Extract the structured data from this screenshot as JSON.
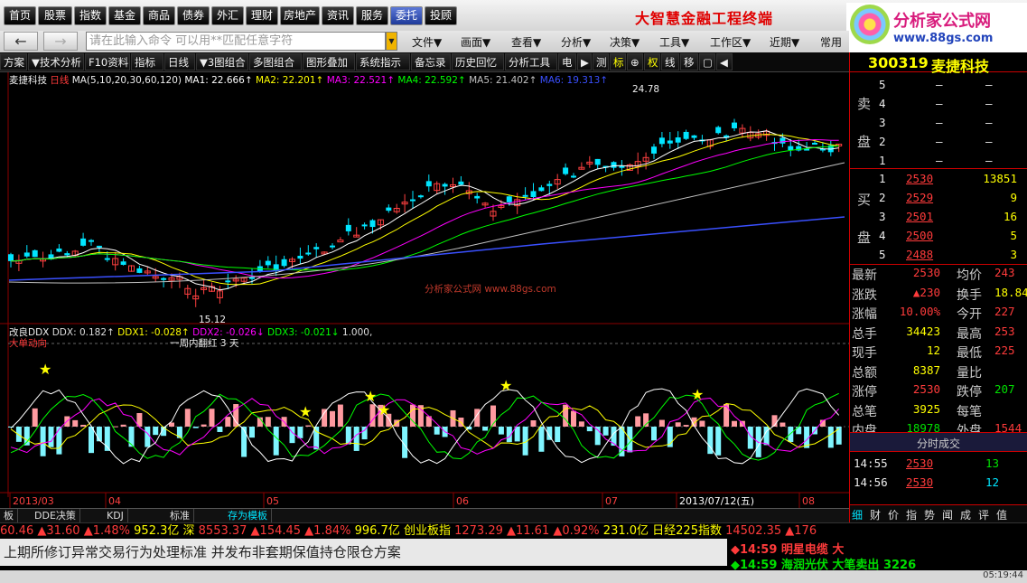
{
  "top_menu": {
    "buttons": [
      "首页",
      "股票",
      "指数",
      "基金",
      "商品",
      "债券",
      "外汇",
      "理财",
      "房地产",
      "资讯",
      "服务",
      "委托",
      "投顾"
    ],
    "active": "委托",
    "app_title": "大智慧金融工程终端"
  },
  "logo": {
    "name": "分析家公式网",
    "url": "www.88gs.com"
  },
  "nav": {
    "back": "←",
    "forward": "→",
    "command_placeholder": "请在此输入命令  可以用**匹配任意字符",
    "menus": [
      "文件▼",
      "画面▼",
      "查看▼",
      "分析▼",
      "决策▼",
      "工具▼",
      "工作区▼",
      "近期▼",
      "常用"
    ]
  },
  "toolbar": {
    "items": [
      "方案",
      "▼技术分析",
      "F10资料",
      "指标",
      "日线",
      "▼3图组合",
      "多图组合",
      "图形叠加",
      "系统指示",
      "备忘录",
      "历史回忆",
      "分析工具",
      "电",
      "▶",
      "测",
      "标",
      "⊕",
      "权",
      "线",
      "移",
      "▢",
      "◀"
    ]
  },
  "chart": {
    "stock_title": "麦捷科技",
    "period": "日线",
    "ma_param": "MA(5,10,20,30,60,120)",
    "ma_values": [
      {
        "label": "MA1: 22.666↑",
        "color": "#ffffff"
      },
      {
        "label": "MA2: 22.201↑",
        "color": "#ffff00"
      },
      {
        "label": "MA3: 22.521↑",
        "color": "#ff00ff"
      },
      {
        "label": "MA4: 22.592↑",
        "color": "#00ff00"
      },
      {
        "label": "MA5: 21.402↑",
        "color": "#c0c0c0"
      },
      {
        "label": "MA6: 19.313↑",
        "color": "#3a50ff"
      }
    ],
    "high_label": "24.78",
    "low_label": "15.12",
    "watermark": "分析家公式网 www.88gs.com",
    "ddx_title": "改良DDX",
    "ddx_values": [
      {
        "label": "DDX: 0.182↑",
        "color": "#dddddd"
      },
      {
        "label": "DDX1: -0.028↑",
        "color": "#ffff00"
      },
      {
        "label": "DDX2: -0.026↓",
        "color": "#ff00ff"
      },
      {
        "label": "DDX3: -0.021↓",
        "color": "#00ff00"
      },
      {
        "label": "1.000,",
        "color": "#dddddd"
      }
    ],
    "sub_label": "大单动向",
    "note": "一周内翻红 3 天",
    "x_labels": [
      "2013/03",
      "04",
      "05",
      "06",
      "07",
      "2013/07/12(五)",
      "08"
    ]
  },
  "bottom_tabs": [
    "板",
    "DDE决策",
    "KDJ",
    "标准",
    "存为模板"
  ],
  "ticker": [
    {
      "t": "60.46",
      "c": "#ff3b3b"
    },
    {
      "t": "▲31.60",
      "c": "#ff3b3b"
    },
    {
      "t": "▲1.48%",
      "c": "#ff3b3b"
    },
    {
      "t": "952.3亿",
      "c": "#ffff00"
    },
    {
      "t": "深",
      "c": "#ffff00"
    },
    {
      "t": "8553.37",
      "c": "#ff3b3b"
    },
    {
      "t": "▲154.45",
      "c": "#ff3b3b"
    },
    {
      "t": "▲1.84%",
      "c": "#ff3b3b"
    },
    {
      "t": "996.7亿",
      "c": "#ffff00"
    },
    {
      "t": "创业板指",
      "c": "#ffff00"
    },
    {
      "t": "1273.29",
      "c": "#ff3b3b"
    },
    {
      "t": "▲11.61",
      "c": "#ff3b3b"
    },
    {
      "t": "▲0.92%",
      "c": "#ff3b3b"
    },
    {
      "t": "231.0亿",
      "c": "#ffff00"
    },
    {
      "t": "日经225指数",
      "c": "#ffff00"
    },
    {
      "t": "14502.35",
      "c": "#ff3b3b"
    },
    {
      "t": "▲176",
      "c": "#ff3b3b"
    }
  ],
  "news": "上期所修订异常交易行为处理标准 并发布非套期保值持仓限仓方案",
  "alerts": [
    {
      "time": "14:59",
      "name": "明星电缆",
      "action": "大",
      "color": "#ff3b3b"
    },
    {
      "time": "14:59",
      "name": "海润光伏",
      "action": "大笔卖出 3226",
      "color": "#00e000"
    }
  ],
  "clock": "05:19:44",
  "side": {
    "code": "300319",
    "name": "麦捷科技",
    "sell_label": "卖 盘",
    "buy_label": "买 盘",
    "sells": [
      {
        "lv": "5",
        "p": "—",
        "v": "—"
      },
      {
        "lv": "4",
        "p": "—",
        "v": "—"
      },
      {
        "lv": "3",
        "p": "—",
        "v": "—"
      },
      {
        "lv": "2",
        "p": "—",
        "v": "—"
      },
      {
        "lv": "1",
        "p": "—",
        "v": "—"
      }
    ],
    "buys": [
      {
        "lv": "1",
        "p": "2530",
        "v": "13851"
      },
      {
        "lv": "2",
        "p": "2529",
        "v": "9"
      },
      {
        "lv": "3",
        "p": "2501",
        "v": "16"
      },
      {
        "lv": "4",
        "p": "2500",
        "v": "5"
      },
      {
        "lv": "5",
        "p": "2488",
        "v": "3"
      }
    ],
    "stats": [
      {
        "l": "最新",
        "v": "2530",
        "vc": "#ff3b3b",
        "l2": "均价",
        "v2": "243",
        "v2c": "#ff3b3b"
      },
      {
        "l": "涨跌",
        "v": "▲230",
        "vc": "#ff3b3b",
        "l2": "换手",
        "v2": "18.84",
        "v2c": "#ffff00"
      },
      {
        "l": "涨幅",
        "v": "10.00%",
        "vc": "#ff3b3b",
        "l2": "今开",
        "v2": "227",
        "v2c": "#ff3b3b"
      },
      {
        "l": "总手",
        "v": "34423",
        "vc": "#ffff00",
        "l2": "最高",
        "v2": "253",
        "v2c": "#ff3b3b"
      },
      {
        "l": "现手",
        "v": "12",
        "vc": "#ffff00",
        "l2": "最低",
        "v2": "225",
        "v2c": "#ff3b3b"
      },
      {
        "l": "总额",
        "v": "8387",
        "vc": "#ffff00",
        "l2": "量比",
        "v2": "",
        "v2c": "#ffff00"
      },
      {
        "l": "涨停",
        "v": "2530",
        "vc": "#ff3b3b",
        "l2": "跌停",
        "v2": "207",
        "v2c": "#00e000"
      },
      {
        "l": "总笔",
        "v": "3925",
        "vc": "#ffff00",
        "l2": "每笔",
        "v2": "",
        "v2c": "#ffff00"
      },
      {
        "l": "内盘",
        "v": "18978",
        "vc": "#00e000",
        "l2": "外盘",
        "v2": "1544",
        "v2c": "#ff3b3b"
      }
    ],
    "ticks_title": "分时成交",
    "ticks": [
      {
        "time": "14:55",
        "p": "2530",
        "v": "13",
        "vc": "#00e000"
      },
      {
        "time": "14:56",
        "p": "2530",
        "v": "12",
        "vc": "#00e5ff"
      }
    ],
    "tabs": [
      "细",
      "财",
      "价",
      "指",
      "势",
      "闻",
      "成",
      "评",
      "值"
    ]
  }
}
